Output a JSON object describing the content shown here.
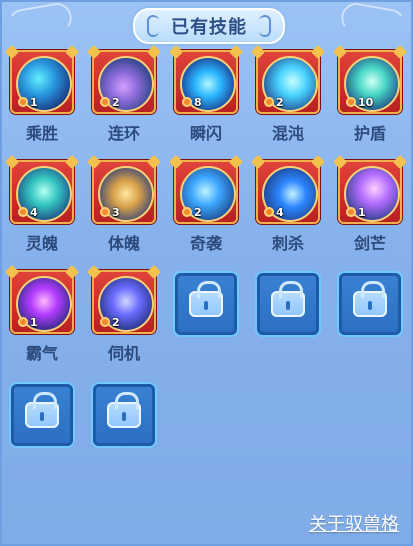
{
  "header": {
    "title": "已有技能"
  },
  "skills": [
    {
      "label": "乘胜",
      "badge": "1",
      "icon": "whale-icon",
      "art": "radial-gradient(circle at 40% 40%, #64f0ff 0%, #2a9be2 35%, #1a3d87 75%)"
    },
    {
      "label": "连环",
      "badge": "2",
      "icon": "rock-mountain-icon",
      "art": "radial-gradient(circle at 45% 55%, #d2a0ff 0%, #8b6ad8 35%, #23407f 80%)"
    },
    {
      "label": "瞬闪",
      "badge": "8",
      "icon": "lightning-beast-icon",
      "art": "radial-gradient(circle at 50% 50%, #b0f6ff 0%, #2ab6ff 35%, #1a3c8f 80%)"
    },
    {
      "label": "混沌",
      "badge": "2",
      "icon": "chaos-bubbles-icon",
      "art": "radial-gradient(circle at 55% 45%, #c6ffff 0%, #49d3ff 35%, #1b3a7f 85%)"
    },
    {
      "label": "护盾",
      "badge": "10",
      "icon": "shield-icon",
      "art": "radial-gradient(circle at 50% 45%, #d3fff9 0%, #49d8c6 35%, #1b3a7f 85%)"
    },
    {
      "label": "灵魄",
      "badge": "4",
      "icon": "spirit-armor-icon",
      "art": "radial-gradient(circle at 50% 45%, #b6fff4 0%, #34c7c1 35%, #1b3a7f 85%)"
    },
    {
      "label": "体魄",
      "badge": "3",
      "icon": "golden-armor-icon",
      "art": "radial-gradient(circle at 50% 50%, #ffe7a0 0%, #d8a24a 35%, #2a3b7a 85%)"
    },
    {
      "label": "奇袭",
      "badge": "2",
      "icon": "strike-icon",
      "art": "radial-gradient(circle at 45% 45%, #bff2ff 0%, #3ca7ff 35%, #1b3a7f 85%)"
    },
    {
      "label": "刺杀",
      "badge": "4",
      "icon": "assassin-icon",
      "art": "radial-gradient(circle at 55% 50%, #c5f1ff 0%, #2d86ff 35%, #1b3a7f 85%)"
    },
    {
      "label": "剑芒",
      "badge": "1",
      "icon": "sword-light-icon",
      "art": "radial-gradient(circle at 55% 40%, #ffd0ff 0%, #b36cff 35%, #1b3a7f 85%)"
    },
    {
      "label": "霸气",
      "badge": "1",
      "icon": "purple-aura-icon",
      "art": "radial-gradient(circle at 50% 45%, #ffb8ff 0%, #b23bff 35%, #1b2a6f 85%)"
    },
    {
      "label": "伺机",
      "badge": "2",
      "icon": "wolf-icon",
      "art": "radial-gradient(circle at 50% 45%, #d2d7ff 0%, #6b6cff 35%, #1b2a6f 85%)"
    }
  ],
  "footer": {
    "link_label": "关于驭兽格"
  },
  "colors": {
    "background": "#8ab6ef",
    "frame_red": "#b81f22",
    "locked_blue": "#2b6fc2"
  }
}
